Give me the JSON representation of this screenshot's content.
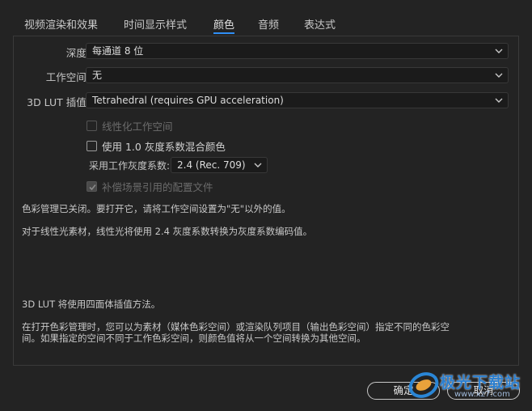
{
  "tabs": [
    {
      "label": "视频渲染和效果",
      "active": false
    },
    {
      "label": "时间显示样式",
      "active": false
    },
    {
      "label": "颜色",
      "active": true
    },
    {
      "label": "音频",
      "active": false
    },
    {
      "label": "表达式",
      "active": false
    }
  ],
  "depth": {
    "label": "深度:",
    "value": "每通道 8 位"
  },
  "workspace": {
    "label": "工作空间:",
    "value": "无"
  },
  "lut_interp": {
    "label": "3D LUT 插值:",
    "value": "Tetrahedral (requires GPU acceleration)"
  },
  "linearize": {
    "label": "线性化工作空间",
    "checked": false,
    "enabled": false
  },
  "blend_gamma": {
    "label": "使用 1.0 灰度系数混合颜色",
    "checked": false,
    "enabled": true
  },
  "work_gamma": {
    "label": "采用工作灰度系数:",
    "value": "2.4 (Rec. 709)"
  },
  "compensate": {
    "label": "补偿场景引用的配置文件",
    "checked": true,
    "enabled": false
  },
  "info": {
    "line1": "色彩管理已关闭。要打开它，请将工作空间设置为\"无\"以外的值。",
    "line2": "对于线性光素材，线性光将使用 2.4 灰度系数转换为灰度系数编码值。",
    "line3": "3D LUT 将使用四面体插值方法。",
    "line4": "在打开色彩管理时，您可以为素材（媒体色彩空间）或渲染队列项目（输出色彩空间）指定不同的色彩空\n间。如果指定的空间不同于工作色彩空间，则颜色值将从一个空间转换为其他空间。"
  },
  "buttons": {
    "ok": "确定",
    "cancel": "取消"
  },
  "watermark": {
    "title": "极光下载站",
    "url": "www.xz7.com"
  },
  "colors": {
    "accent": "#2f8ef5",
    "background": "#232323"
  }
}
